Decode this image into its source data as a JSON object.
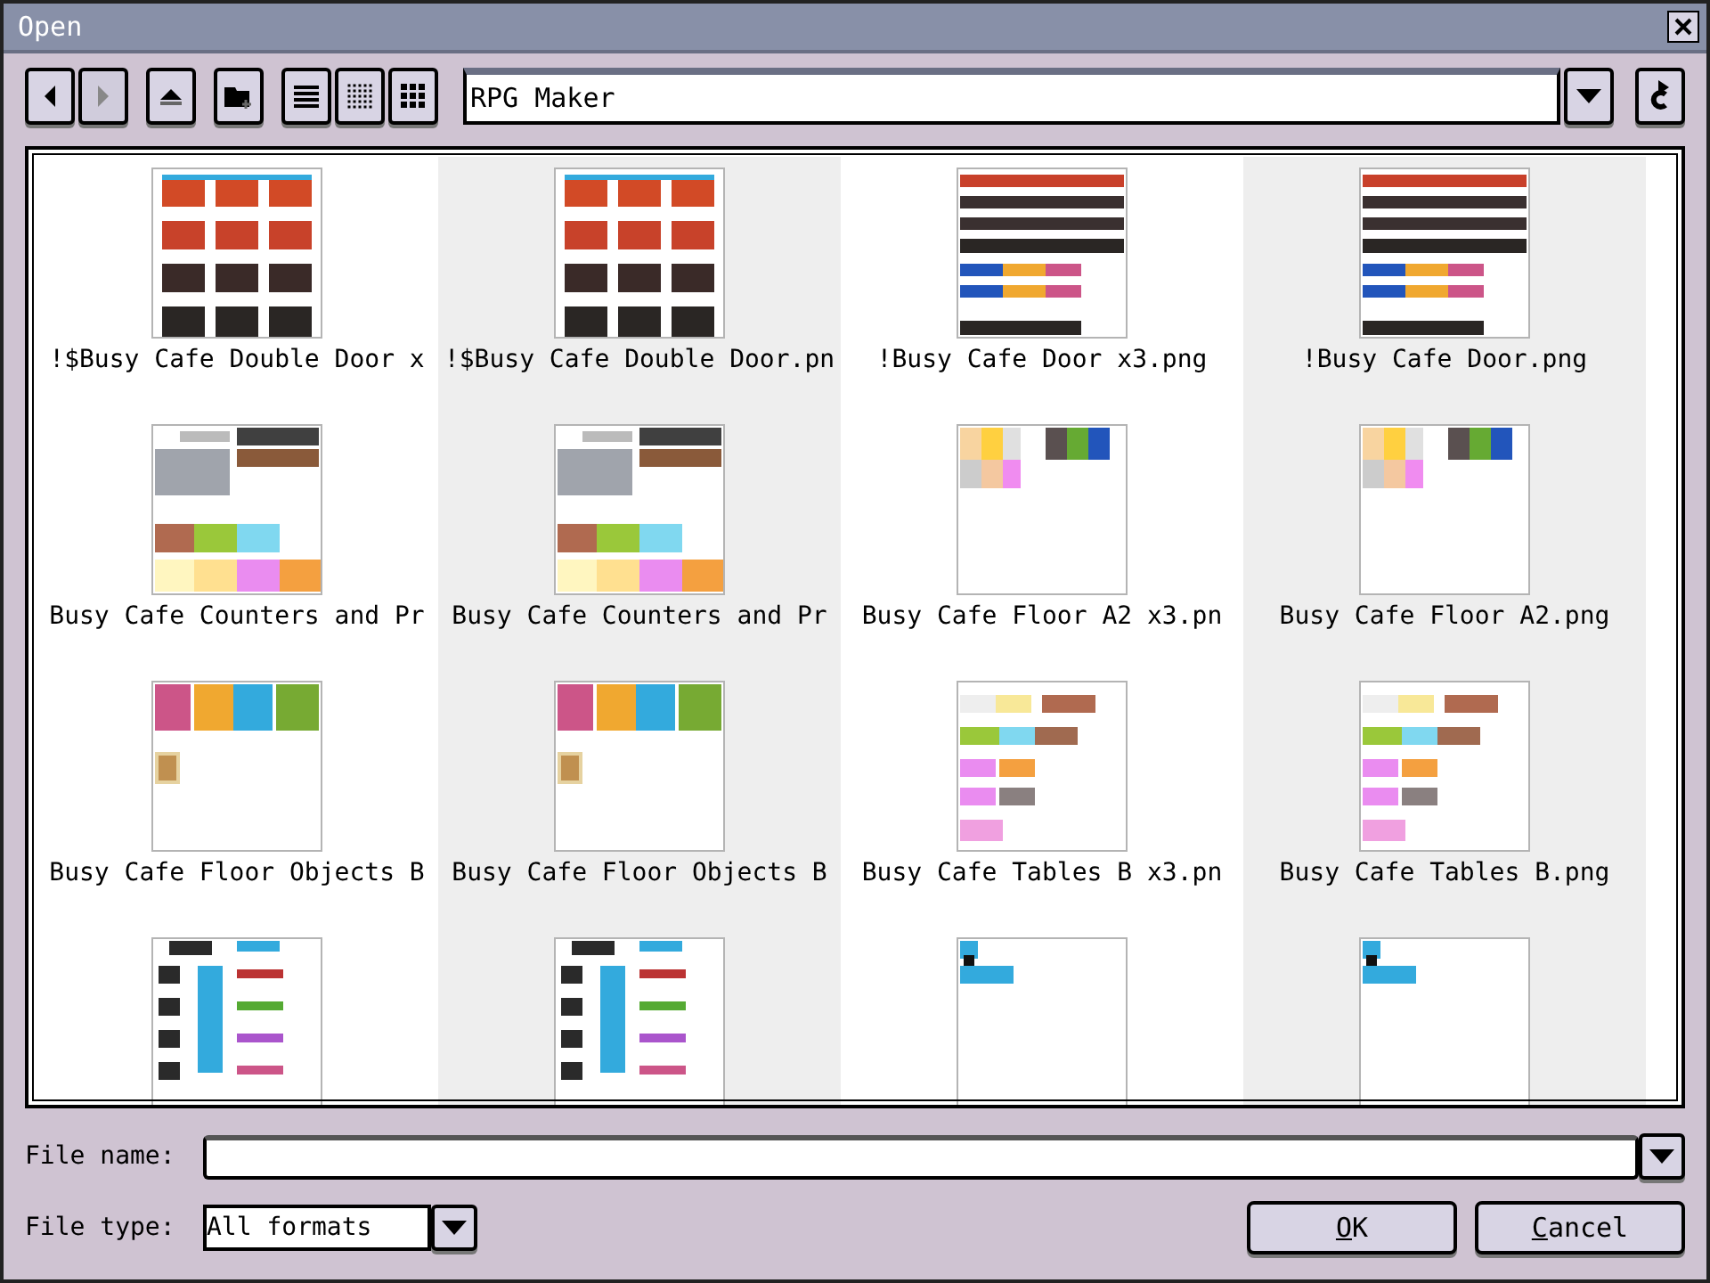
{
  "window": {
    "title": "Open"
  },
  "toolbar": [
    {
      "kind": "back",
      "disabled": false
    },
    {
      "kind": "forward",
      "disabled": true
    },
    {
      "kind": "up",
      "disabled": false
    },
    {
      "kind": "new-folder",
      "disabled": false
    },
    {
      "kind": "list-view",
      "disabled": false
    },
    {
      "kind": "small-icons",
      "disabled": false
    },
    {
      "kind": "large-icons",
      "disabled": false
    }
  ],
  "location": {
    "value": "RPG Maker"
  },
  "files": [
    {
      "kind": "picture",
      "name": "!$Busy Cafe Double Door x"
    },
    {
      "kind": "picture",
      "name": "!$Busy Cafe Double Door.pn"
    },
    {
      "kind": "picture",
      "name": "!Busy Cafe Door x3.png"
    },
    {
      "kind": "picture",
      "name": "!Busy Cafe Door.png"
    },
    {
      "kind": "picture",
      "name": "Busy Cafe Counters and Pr"
    },
    {
      "kind": "picture",
      "name": "Busy Cafe Counters and Pr"
    },
    {
      "kind": "picture",
      "name": "Busy Cafe Floor A2 x3.pn"
    },
    {
      "kind": "picture",
      "name": "Busy Cafe Floor A2.png"
    },
    {
      "kind": "picture",
      "name": "Busy Cafe Floor Objects B"
    },
    {
      "kind": "picture",
      "name": "Busy Cafe Floor Objects B"
    },
    {
      "kind": "picture",
      "name": "Busy Cafe Tables B x3.pn"
    },
    {
      "kind": "picture",
      "name": "Busy Cafe Tables B.png"
    },
    {
      "kind": "picture"
    },
    {
      "kind": "picture"
    },
    {
      "kind": "picture"
    },
    {
      "kind": "picture"
    }
  ],
  "file_name": {
    "label": "File name:"
  },
  "file_type": {
    "label": "File type:",
    "value": "All formats"
  },
  "buttons": [
    {
      "label": "OK"
    },
    {
      "label": "Cancel"
    }
  ]
}
